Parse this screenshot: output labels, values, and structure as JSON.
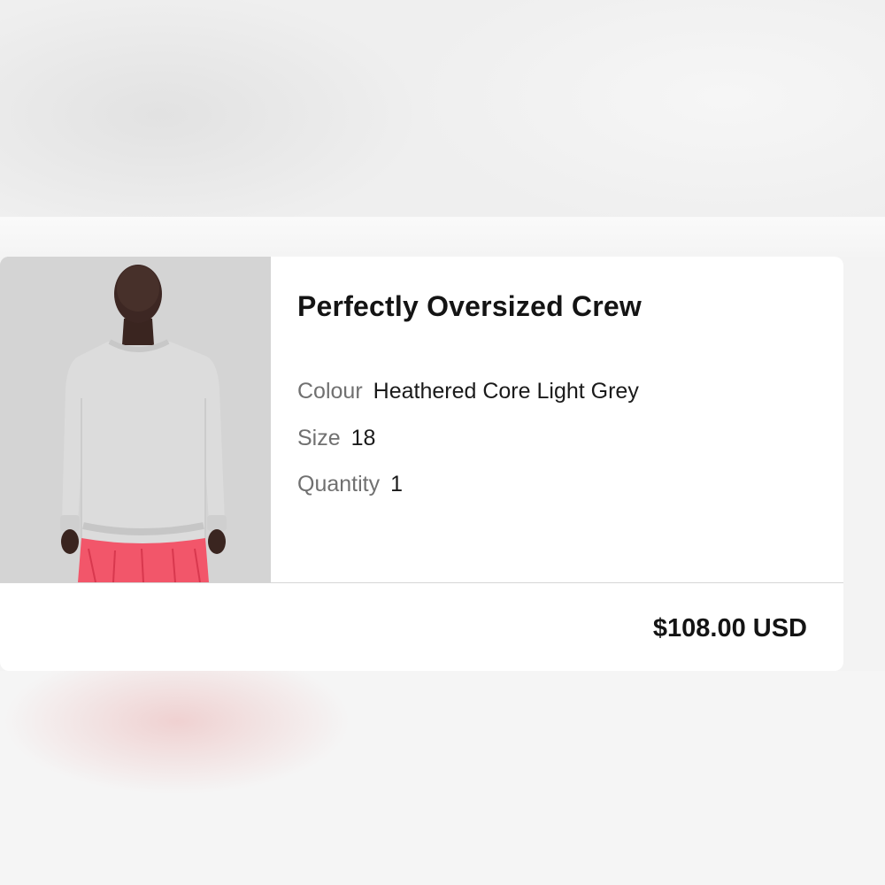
{
  "product": {
    "title": "Perfectly Oversized Crew",
    "image_description_icon": "product-photo",
    "attributes": {
      "colour_label": "Colour",
      "colour_value": "Heathered Core Light Grey",
      "size_label": "Size",
      "size_value": "18",
      "quantity_label": "Quantity",
      "quantity_value": "1"
    },
    "price": "$108.00 USD"
  },
  "colors": {
    "card_background": "#ffffff",
    "text_primary": "#141414",
    "text_label": "#707070",
    "image_background": "#d4d4d4",
    "sweater": "#dcdcdc",
    "skirt": "#f2566a"
  }
}
